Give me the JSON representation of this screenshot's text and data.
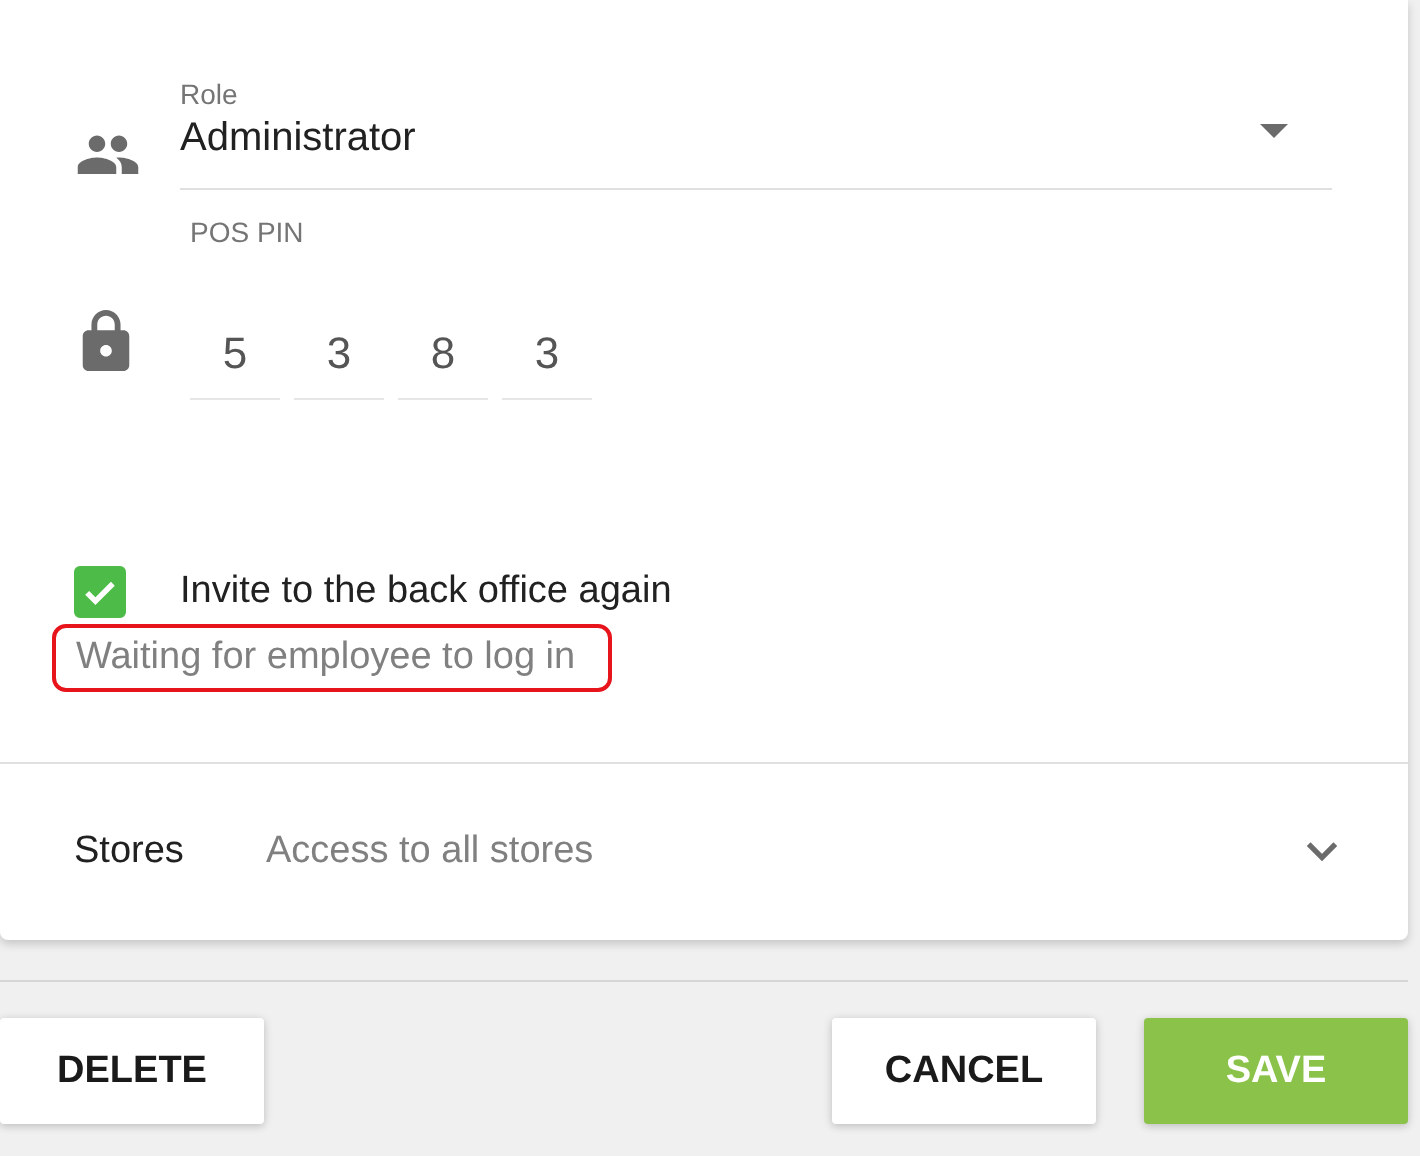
{
  "role": {
    "label": "Role",
    "value": "Administrator"
  },
  "pos_pin": {
    "label": "POS PIN",
    "digits": [
      "5",
      "3",
      "8",
      "3"
    ]
  },
  "invite": {
    "label": "Invite to the back office again",
    "checked": true
  },
  "status": {
    "text": "Waiting for employee to log in",
    "highlighted": true
  },
  "stores": {
    "label": "Stores",
    "value": "Access to all stores"
  },
  "footer": {
    "left_buttons": [
      {
        "label": "DELETE",
        "primary": false
      }
    ],
    "right_buttons": [
      {
        "label": "CANCEL",
        "primary": false
      },
      {
        "label": "SAVE",
        "primary": true
      }
    ]
  }
}
